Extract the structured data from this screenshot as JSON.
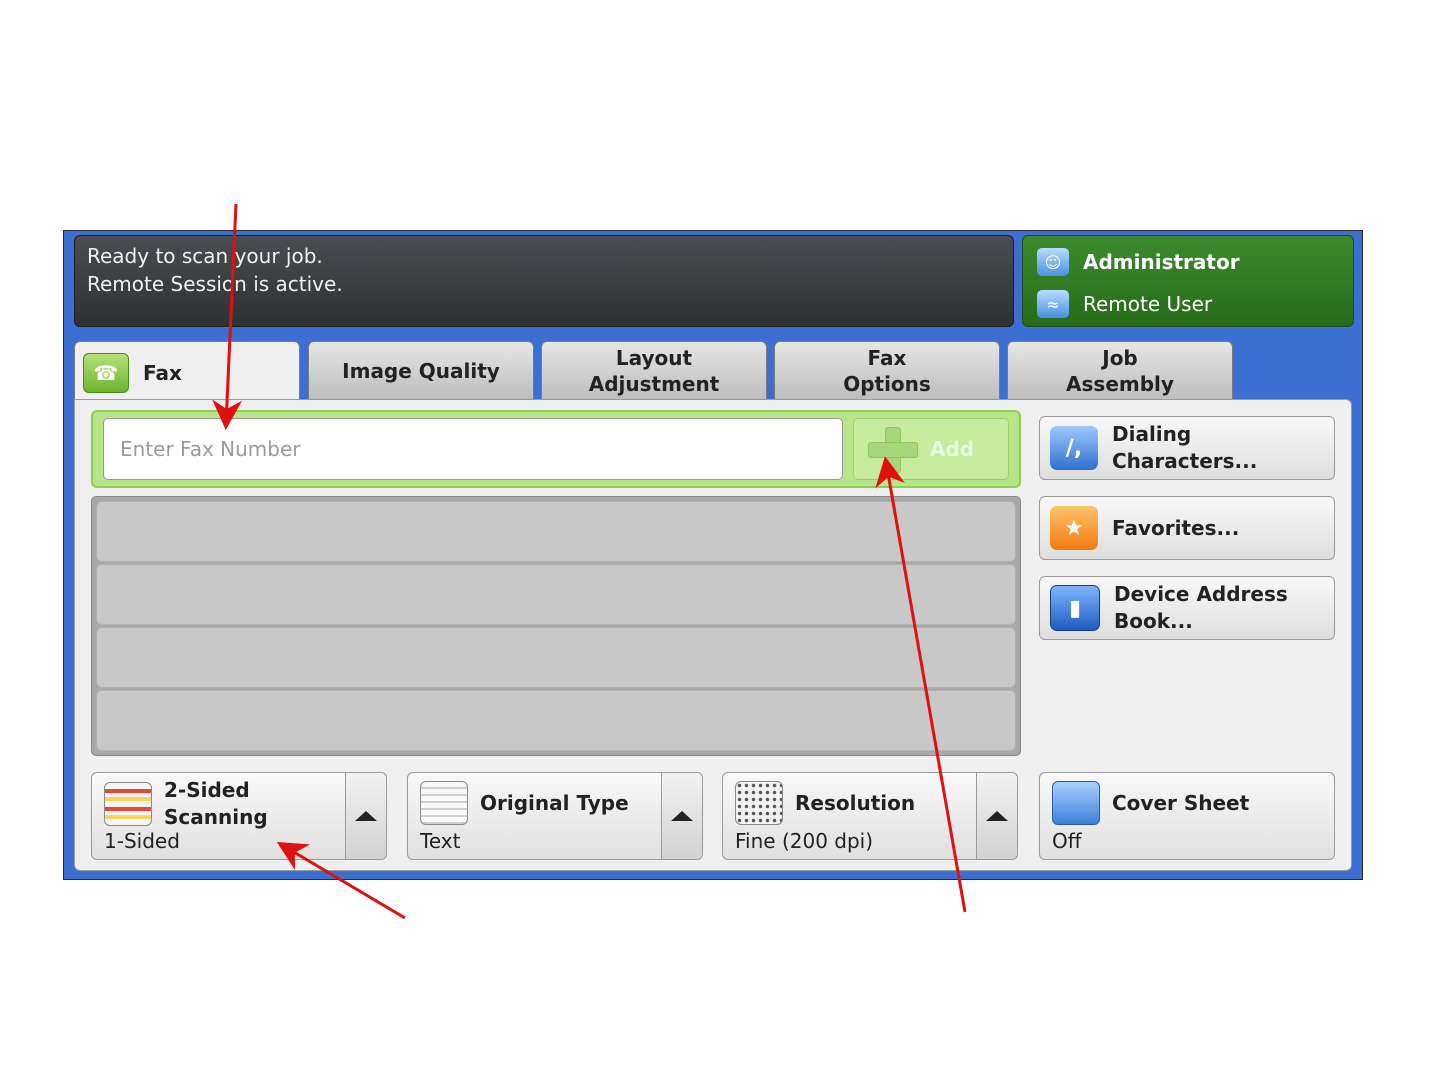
{
  "status": {
    "line1": "Ready to scan your job.",
    "line2": "Remote Session is active."
  },
  "user": {
    "role": "Administrator",
    "session": "Remote User"
  },
  "tabs": [
    {
      "label": "Fax",
      "icon": "fax-icon"
    },
    {
      "label": "Image Quality"
    },
    {
      "label": "Layout Adjustment"
    },
    {
      "label": "Fax Options"
    },
    {
      "label": "Job Assembly"
    }
  ],
  "entry": {
    "placeholder": "Enter Fax Number",
    "value": "",
    "add_label": "Add"
  },
  "side_buttons": [
    {
      "label": "Dialing Characters...",
      "icon": "dialing-characters-icon"
    },
    {
      "label": "Favorites...",
      "icon": "star-icon"
    },
    {
      "label": "Device Address Book...",
      "icon": "address-book-icon"
    }
  ],
  "options": [
    {
      "label": "2-Sided Scanning",
      "value": "1-Sided",
      "icon": "two-sided-icon"
    },
    {
      "label": "Original Type",
      "value": "Text",
      "icon": "document-icon"
    },
    {
      "label": "Resolution",
      "value": "Fine (200 dpi)",
      "icon": "resolution-grid-icon"
    },
    {
      "label": "Cover Sheet",
      "value": "Off",
      "icon": "cover-sheet-icon"
    }
  ],
  "colors": {
    "panel_blue": "#3b6fd1",
    "user_green": "#2f7a22",
    "entry_green": "#b9e58a",
    "annotation_arrow": "#e01010"
  }
}
